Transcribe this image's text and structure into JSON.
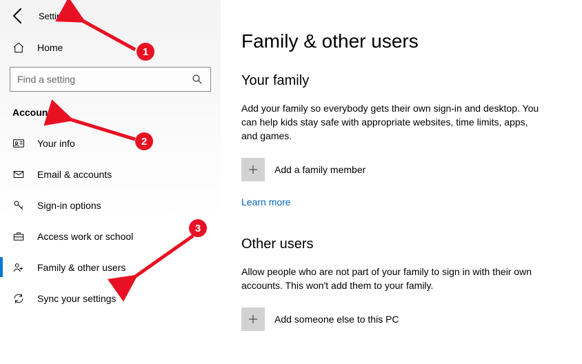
{
  "header": {
    "app_title": "Settings"
  },
  "search": {
    "placeholder": "Find a setting"
  },
  "home_label": "Home",
  "category": "Accounts",
  "nav": [
    {
      "label": "Your info"
    },
    {
      "label": "Email & accounts"
    },
    {
      "label": "Sign-in options"
    },
    {
      "label": "Access work or school"
    },
    {
      "label": "Family & other users"
    },
    {
      "label": "Sync your settings"
    }
  ],
  "main": {
    "title": "Family & other users",
    "family_h": "Your family",
    "family_p": "Add your family so everybody gets their own sign-in and desktop. You can help kids stay safe with appropriate websites, time limits, apps, and games.",
    "add_family": "Add a family member",
    "learn_more": "Learn more",
    "other_h": "Other users",
    "other_p": "Allow people who are not part of your family to sign in with their own accounts. This won't add them to your family.",
    "add_other": "Add someone else to this PC"
  },
  "annotations": {
    "1": "1",
    "2": "2",
    "3": "3"
  }
}
